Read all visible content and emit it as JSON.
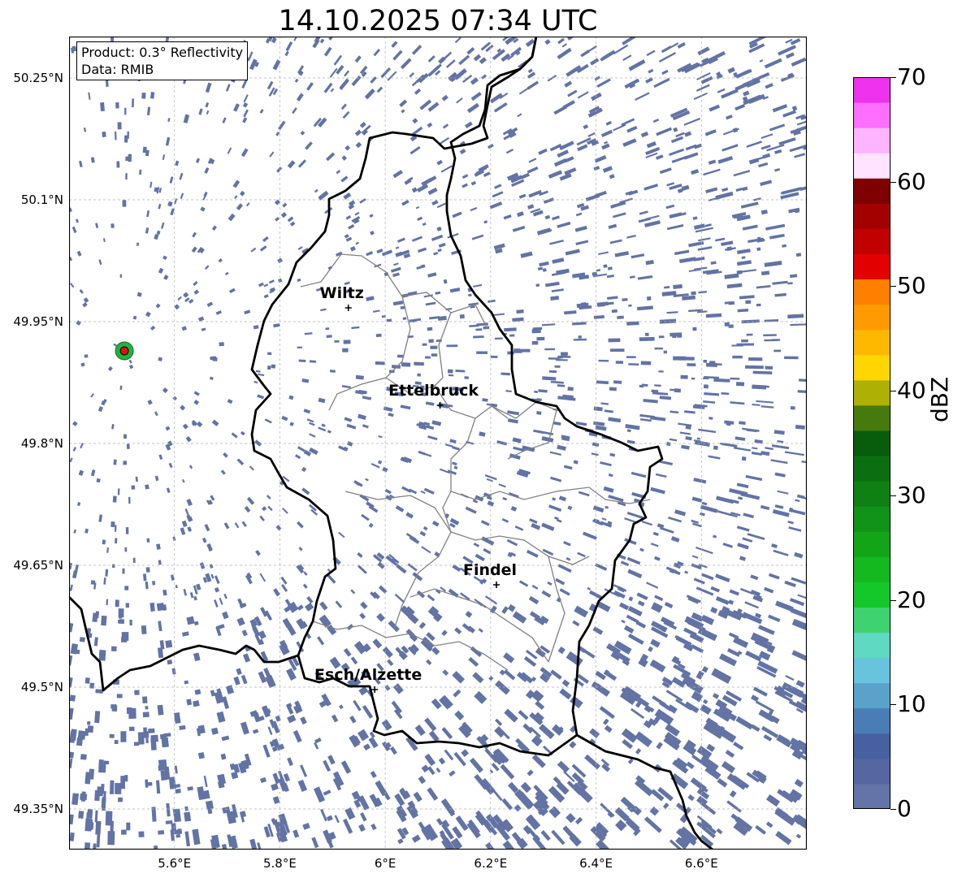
{
  "title": "14.10.2025 07:34 UTC",
  "info_box": {
    "product": "Product: 0.3° Reflectivity",
    "data": "Data: RMIB"
  },
  "map": {
    "lon_range": [
      5.4,
      6.8
    ],
    "lat_range": [
      49.3,
      50.3
    ],
    "lat_ticks": [
      {
        "value": 50.25,
        "label": "50.25°N"
      },
      {
        "value": 50.1,
        "label": "50.1°N"
      },
      {
        "value": 49.95,
        "label": "49.95°N"
      },
      {
        "value": 49.8,
        "label": "49.8°N"
      },
      {
        "value": 49.65,
        "label": "49.65°N"
      },
      {
        "value": 49.5,
        "label": "49.5°N"
      },
      {
        "value": 49.35,
        "label": "49.35°N"
      }
    ],
    "lon_ticks": [
      {
        "value": 5.6,
        "label": "5.6°E"
      },
      {
        "value": 5.8,
        "label": "5.8°E"
      },
      {
        "value": 6.0,
        "label": "6°E"
      },
      {
        "value": 6.2,
        "label": "6.2°E"
      },
      {
        "value": 6.4,
        "label": "6.4°E"
      },
      {
        "value": 6.6,
        "label": "6.6°E"
      }
    ],
    "cities": [
      {
        "name": "Wiltz",
        "lon": 5.93,
        "lat": 49.967
      },
      {
        "name": "Ettelbruck",
        "lon": 6.104,
        "lat": 49.847
      },
      {
        "name": "Findel",
        "lon": 6.211,
        "lat": 49.626
      },
      {
        "name": "Esch/Alzette",
        "lon": 5.98,
        "lat": 49.497
      }
    ],
    "radar_site": {
      "lon": 5.505,
      "lat": 49.914
    },
    "grid": true
  },
  "colorbar": {
    "label": "dBZ",
    "min": 0,
    "max": 70,
    "ticks": [
      {
        "value": 0,
        "label": "0"
      },
      {
        "value": 10,
        "label": "10"
      },
      {
        "value": 20,
        "label": "20"
      },
      {
        "value": 30,
        "label": "30"
      },
      {
        "value": 40,
        "label": "40"
      },
      {
        "value": 50,
        "label": "50"
      },
      {
        "value": 60,
        "label": "60"
      },
      {
        "value": 70,
        "label": "70"
      }
    ],
    "colors": [
      "#6474a6",
      "#5666a0",
      "#4760a2",
      "#4a7db5",
      "#5ba2cb",
      "#67c4dc",
      "#5fd9c1",
      "#3fd270",
      "#14c82a",
      "#13b91f",
      "#12a518",
      "#11931a",
      "#0e8014",
      "#0b6f12",
      "#075d0c",
      "#477a0c",
      "#aeb004",
      "#ffd600",
      "#ffb800",
      "#ff9a00",
      "#ff8000",
      "#e30000",
      "#c20000",
      "#a30000",
      "#7f0000",
      "#ffe3ff",
      "#ffb4ff",
      "#ff6eff",
      "#ee32ee"
    ]
  },
  "echo_color": "#6273a4"
}
